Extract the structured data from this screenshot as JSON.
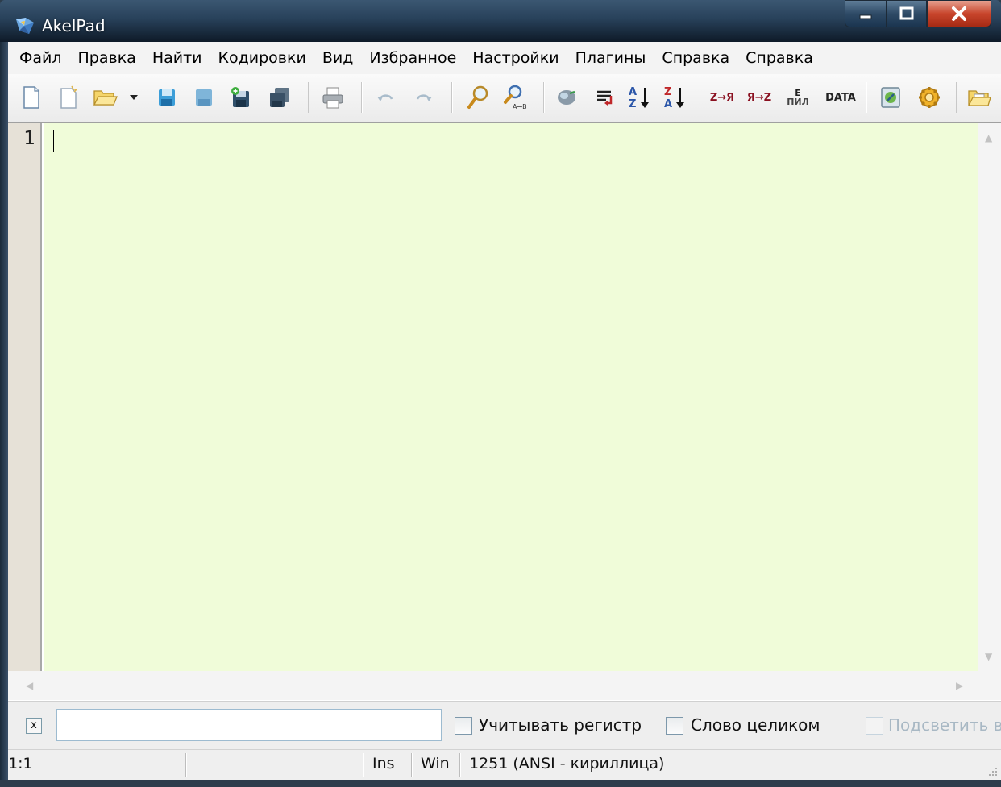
{
  "window": {
    "title": "AkelPad"
  },
  "menu": {
    "items": [
      "Файл",
      "Правка",
      "Найти",
      "Кодировки",
      "Вид",
      "Избранное",
      "Настройки",
      "Плагины",
      "Справка",
      "Справка"
    ]
  },
  "toolbar": {
    "buttons": [
      {
        "name": "new-file-icon"
      },
      {
        "name": "new-window-icon"
      },
      {
        "name": "open-folder-icon"
      },
      {
        "name": "open-dropdown-icon"
      },
      {
        "name": "save-icon"
      },
      {
        "name": "save-disabled-icon"
      },
      {
        "name": "save-as-icon"
      },
      {
        "name": "save-all-icon"
      },
      {
        "name": "print-icon"
      },
      {
        "name": "undo-icon"
      },
      {
        "name": "redo-icon"
      },
      {
        "name": "find-icon"
      },
      {
        "name": "replace-icon"
      },
      {
        "name": "go-to-icon"
      },
      {
        "name": "word-wrap-icon"
      },
      {
        "name": "sort-asc-icon"
      },
      {
        "name": "sort-desc-icon"
      },
      {
        "name": "convert-lat-cyr-icon"
      },
      {
        "name": "convert-cyr-lat-icon"
      },
      {
        "name": "transliterate-icon"
      },
      {
        "name": "insert-date-icon"
      },
      {
        "name": "edit-document-icon"
      },
      {
        "name": "settings-gear-icon"
      },
      {
        "name": "favorites-folder-icon"
      }
    ],
    "convert_lat_cyr_label": "Z→Я",
    "convert_cyr_lat_label": "Я→Z",
    "date_label": "DATA",
    "translit_top": "E",
    "translit_bottom": "ПИЛ"
  },
  "editor": {
    "line_numbers": [
      "1"
    ],
    "text": "",
    "background": "#f0fcd9"
  },
  "findbar": {
    "close_label": "x",
    "input_value": "",
    "match_case_label": "Учитывать регистр",
    "whole_word_label": "Слово целиком",
    "highlight_label": "Подсветить в"
  },
  "statusbar": {
    "position": "1:1",
    "insert_mode": "Ins",
    "newline": "Win",
    "codepage": "1251  (ANSI - кириллица)"
  }
}
